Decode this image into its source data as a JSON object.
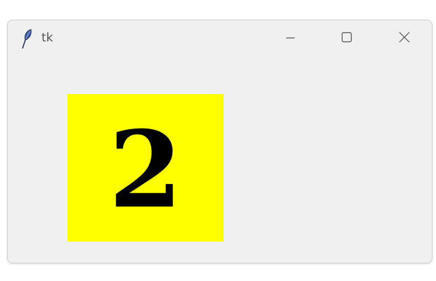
{
  "window": {
    "title": "tk",
    "app_icon": "feather-icon",
    "controls": {
      "minimize_icon": "minimize-icon",
      "maximize_icon": "maximize-icon",
      "close_icon": "close-icon"
    }
  },
  "content": {
    "tile_value": "2",
    "tile_background": "#ffff00",
    "tile_text_color": "#000000"
  }
}
